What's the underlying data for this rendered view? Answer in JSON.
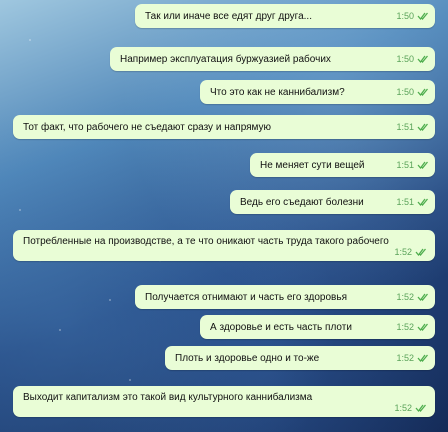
{
  "messages": [
    {
      "text": "Так или иначе все едят друг друга...",
      "time": "1:50"
    },
    {
      "text": "Например эксплуатация буржуазией рабочих",
      "time": "1:50"
    },
    {
      "text": "Что это как не каннибализм?",
      "time": "1:50"
    },
    {
      "text": "Тот факт, что рабочего не съедают сразу и напрямую",
      "time": "1:51"
    },
    {
      "text": "Не меняет сути вещей",
      "time": "1:51"
    },
    {
      "text": "Ведь его съедают болезни",
      "time": "1:51"
    },
    {
      "text": "Потребленные на производстве, а те что оникают часть труда такого рабочего",
      "time": "1:52"
    },
    {
      "text": "Получается отнимают и часть его здоровья",
      "time": "1:52"
    },
    {
      "text": "А здоровье и есть часть плоти",
      "time": "1:52"
    },
    {
      "text": "Плоть и здоровье одно и то-же",
      "time": "1:52"
    },
    {
      "text": "Выходит капитализм это такой вид культурного каннибализма",
      "time": "1:52"
    }
  ],
  "colors": {
    "bubble": "#e9fdd6",
    "time": "#5aa35a",
    "check": "#4fae4e"
  },
  "icons": {
    "read_receipt": "double-check-icon"
  }
}
